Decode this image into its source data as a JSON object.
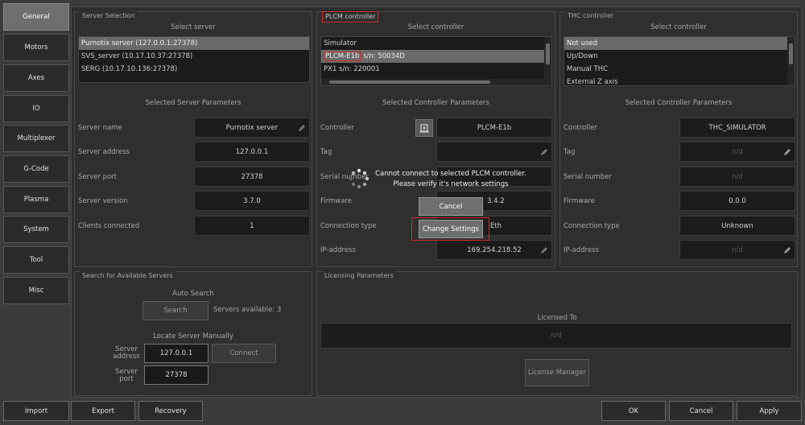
{
  "sidebar": {
    "items": [
      {
        "label": "General",
        "active": true
      },
      {
        "label": "Motors"
      },
      {
        "label": "Axes"
      },
      {
        "label": "IO"
      },
      {
        "label": "Multiplexer"
      },
      {
        "label": "G-Code"
      },
      {
        "label": "Plasma"
      },
      {
        "label": "System"
      },
      {
        "label": "Tool"
      },
      {
        "label": "Misc"
      }
    ]
  },
  "server_selection": {
    "title": "Server Selection",
    "select_label": "Select server",
    "servers": [
      "Purnotix server (127.0.0.1:27378)",
      "SVS_server (10.17.10.37:27378)",
      "SERG (10.17.10.136:27378)"
    ],
    "params_title": "Selected Server Parameters",
    "params": [
      {
        "label": "Server name",
        "value": "Purnotix server"
      },
      {
        "label": "Server address",
        "value": "127.0.0.1"
      },
      {
        "label": "Server port",
        "value": "27378"
      },
      {
        "label": "Server version",
        "value": "3.7.0"
      },
      {
        "label": "Clients connected",
        "value": "1"
      }
    ]
  },
  "plcm": {
    "title": "PLCM controller",
    "select_label": "Select controller",
    "list": [
      {
        "label": "Simulator"
      },
      {
        "label": "PLCM-E1b",
        "suffix": "s/n: 50034D"
      },
      {
        "label": "PX1 s/n: 220001"
      }
    ],
    "params_title": "Selected Controller Parameters",
    "params": [
      {
        "label": "Controller",
        "value": "PLCM-E1b"
      },
      {
        "label": "Tag",
        "value": ""
      },
      {
        "label": "Serial number",
        "value": ""
      },
      {
        "label": "Firmware",
        "value": "3.4.2"
      },
      {
        "label": "Connection type",
        "value": "Eth"
      },
      {
        "label": "IP-address",
        "value": "169.254.218.52"
      }
    ]
  },
  "thc": {
    "title": "THC controller",
    "select_label": "Select controller",
    "list": [
      "Not used",
      "Up/Down",
      "Manual THC",
      "External Z axis"
    ],
    "params_title": "Selected Controller Parameters",
    "params": [
      {
        "label": "Controller",
        "value": "THC_SIMULATOR"
      },
      {
        "label": "Tag",
        "value": "n/d"
      },
      {
        "label": "Serial number",
        "value": "n/d"
      },
      {
        "label": "Firmware",
        "value": "0.0.0"
      },
      {
        "label": "Connection type",
        "value": "Unknown"
      },
      {
        "label": "IP-address",
        "value": "n/d"
      }
    ]
  },
  "search": {
    "title": "Search for Available Servers",
    "auto_label": "Auto Search",
    "search_button": "Search",
    "servers_available": "Servers available: 3",
    "locate_label": "Locate Server Manually",
    "address_label": "Server address",
    "address_value": "127.0.0.1",
    "connect_button": "Connect",
    "port_label": "Server port",
    "port_value": "27378"
  },
  "licensing": {
    "title": "Licensing Parameters",
    "licensed_to_label": "Licensed To",
    "licensed_to_value": "n/d",
    "manager_button": "License Manager"
  },
  "dialog": {
    "message_line1": "Cannot connect to selected PLCM controller.",
    "message_line2": "Please verify it's network settings",
    "cancel_label": "Cancel",
    "change_label": "Change Settings"
  },
  "footer": {
    "import": "Import",
    "export": "Export",
    "recovery": "Recovery",
    "ok": "OK",
    "cancel": "Cancel",
    "apply": "Apply"
  },
  "colors": {
    "highlight_red": "#d42a2a",
    "selected_item": "#6a6a6a"
  }
}
